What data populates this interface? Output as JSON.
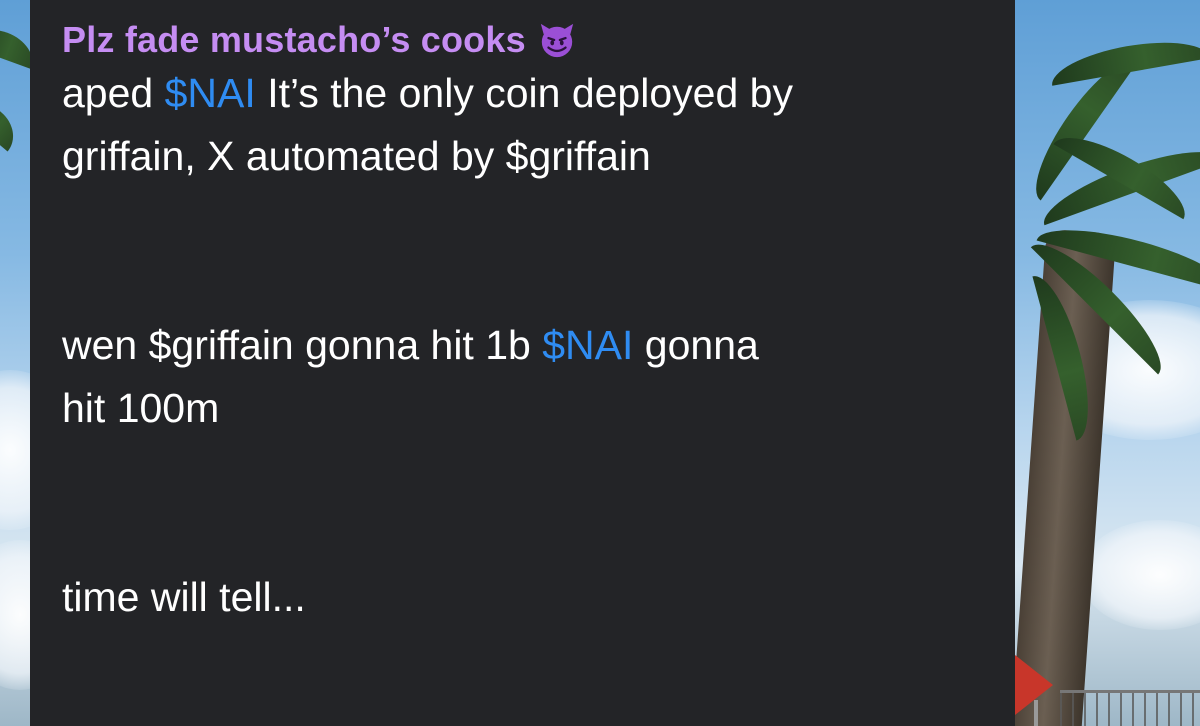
{
  "message": {
    "sender_name": "Plz fade mustacho’s cooks",
    "sender_icon": "smiling-devil-emoji-icon",
    "line1_prefix": "aped",
    "line1_tag": "$NAI",
    "line1_suffix": "It’s the only coin deployed by",
    "line2": "griffain, X automated by $griffain",
    "line3_prefix": "wen $griffain gonna hit 1b",
    "line3_tag": "$NAI",
    "line3_suffix": "gonna",
    "line4": "hit 100m",
    "line5": "time will tell..."
  },
  "colors": {
    "bubble_background": "#232427",
    "sender_name": "#c58df2",
    "cashtag_link": "#2f8cf2",
    "message_text": "#ffffff"
  }
}
